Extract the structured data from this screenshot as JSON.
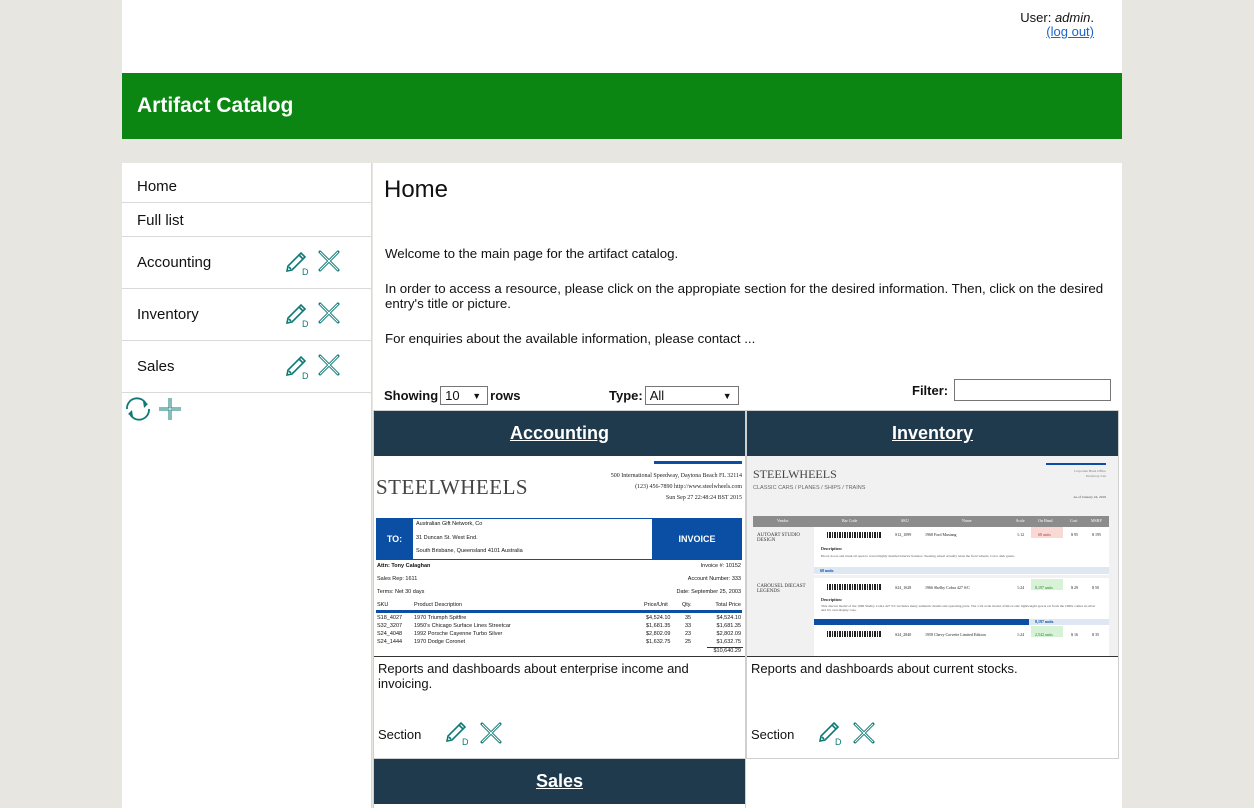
{
  "header": {
    "user_prefix": "User:",
    "user_name": "admin",
    "user_suffix": ".",
    "logout_label": "(log out)",
    "app_title": "Artifact Catalog",
    "accent_color": "#0b8612"
  },
  "sidebar": {
    "home": "Home",
    "full_list": "Full list",
    "sections": [
      "Accounting",
      "Inventory",
      "Sales"
    ],
    "edit_icon": "edit-d-icon",
    "delete_icon": "close-x-icon",
    "reload_icon": "refresh-icon",
    "add_icon": "plus-icon"
  },
  "main": {
    "title": "Home",
    "welcome": "Welcome to the main page for the artifact catalog.",
    "instructions": "In order to access a resource, please click on the appropiate section for the desired information. Then, click on the desired entry's title or picture.",
    "contact": "For enquiries about the available information, please contact ..."
  },
  "controls": {
    "showing_label": "Showing",
    "rows_value": "10",
    "rows_label": "rows",
    "type_label": "Type:",
    "type_value": "All",
    "filter_label": "Filter:",
    "filter_value": ""
  },
  "cards": [
    {
      "title": "Accounting",
      "description": "Reports and dashboards about enterprise income and invoicing.",
      "footer_label": "Section",
      "thumb": {
        "brand": "STEELWHEELS",
        "address": "500 International Speedway, Daytona Beach  FL 32114",
        "phone": "(123) 456-7890  http://www.steelwheels.com",
        "date": "Sun Sep 27 22:48:24 BST 2015",
        "to_label": "TO:",
        "to_lines": [
          "Australian Gift Network, Co",
          "31 Duncan St. West End.",
          "South Brisbane, Queensland  4101   Australia"
        ],
        "invoice_label": "INVOICE",
        "attn": "Attn: Tony Calaghan",
        "invoice_no": "Invoice #:  10152",
        "sales_rep": "Sales Rep:  1611",
        "account": "Account Number:  333",
        "terms": "Terms: Net 30 days",
        "inv_date": "Date:  September 25, 2003",
        "columns": [
          "SKU",
          "Product Description",
          "Price/Unit",
          "Qty.",
          "Total Price"
        ],
        "rows": [
          [
            "S18_4027",
            "1970 Triumph Spitfire",
            "$4,524.10",
            "35",
            "$4,524.10"
          ],
          [
            "S32_3207",
            "1950's Chicago Surface Lines Streetcar",
            "$1,681.35",
            "33",
            "$1,681.35"
          ],
          [
            "S24_4048",
            "1992 Porsche Cayenne Turbo Silver",
            "$2,802.09",
            "23",
            "$2,802.09"
          ],
          [
            "S24_1444",
            "1970 Dodge Coronet",
            "$1,632.75",
            "25",
            "$1,632.75"
          ]
        ],
        "total": "$10,640.29"
      }
    },
    {
      "title": "Inventory",
      "description": "Reports and dashboards about current stocks.",
      "footer_label": "Section",
      "thumb": {
        "brand": "STEELWHEELS",
        "nav": "CLASSIC CARS  /  PLANES  /  SHIPS  /  TRAINS",
        "office": "Corporate Head Office",
        "report": "Inventory List",
        "asof": "As of January 24, 2016",
        "columns": [
          "Vendor",
          "Bar Code",
          "SKU",
          "Name",
          "Scale",
          "On Hand",
          "Cost",
          "MSRP"
        ],
        "vendor1": "AUTOART STUDIO DESIGN",
        "vendor2": "CAROUSEL DIECAST LEGENDS",
        "rows": [
          [
            "S12_1099",
            "1968 Ford Mustang",
            "1:12",
            "68 units",
            "$ 95",
            "$ 195"
          ],
          [
            "S24_1628",
            "1966 Shelby Cobra 427 S/C",
            "1:24",
            "8,197 units",
            "$ 29",
            "$ 50"
          ],
          [
            "S24_2840",
            "1958 Chevy Corvette Limited Edition",
            "1:24",
            "2,542 units",
            "$ 16",
            "$ 35"
          ]
        ],
        "desc_label": "Description:",
        "desc1": "Hood, doors and trunk all open to reveal highly detailed interior features. Steering wheel actually turns the front wheels. Color dark green.",
        "desc2": "This diecast model of the 1966 Shelby Cobra 427 S/C includes many authentic details and operating parts. The 1:24 scale model of this iconic lightweight sports car from the 1960s comes in silver and it's own display case.",
        "units1": "68 units",
        "units2": "8,197 units"
      }
    },
    {
      "title": "Sales"
    }
  ],
  "colors": {
    "card_header": "#1e3a4c",
    "icon_teal": "#0e7a76",
    "invoice_blue": "#0a4fa3"
  }
}
